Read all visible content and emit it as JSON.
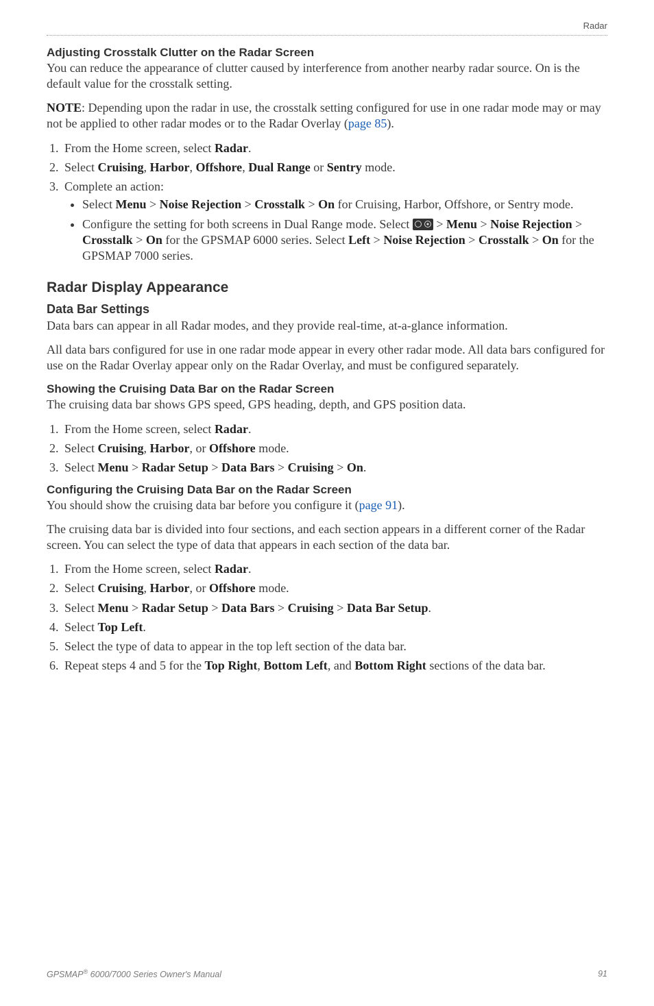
{
  "header": {
    "section": "Radar"
  },
  "s1": {
    "title": "Adjusting Crosstalk Clutter on the Radar Screen",
    "p1a": "You can reduce the appearance of clutter caused by interference from another nearby radar source. On is the default value for the crosstalk setting.",
    "p2_pre": "NOTE",
    "p2_body": ": Depending upon the radar in use, the crosstalk setting configured for use in one radar mode may or may not be applied to other radar modes or to the Radar Overlay (",
    "p2_link": "page 85",
    "p2_close": ").",
    "li1_pre": "From the Home screen, select ",
    "li1_l1": "Radar",
    "li1_post": ".",
    "li2_pre": "Select ",
    "li2_l1": "Cruising",
    "li2_c1": ", ",
    "li2_l2": "Harbor",
    "li2_c2": ", ",
    "li2_l3": "Offshore",
    "li2_c3": ", ",
    "li2_l4": "Dual Range",
    "li2_c4": " or ",
    "li2_l5": "Sentry",
    "li2_post": " mode.",
    "li3": "Complete an action:",
    "b1_pre": "Select ",
    "b1_l1": "Menu",
    "b1_gt1": " > ",
    "b1_l2": "Noise Rejection",
    "b1_gt2": " > ",
    "b1_l3": "Crosstalk",
    "b1_gt3": " > ",
    "b1_l4": "On",
    "b1_post": " for Cruising, Harbor, Offshore, or Sentry mode.",
    "b2_pre": "Configure the setting for both screens in Dual Range mode. Select ",
    "b2_gt0": " > ",
    "b2_l1": "Menu",
    "b2_gt1": " > ",
    "b2_l2": "Noise Rejection",
    "b2_gt2": " > ",
    "b2_l3": "Crosstalk",
    "b2_gt3": " > ",
    "b2_l4": "On",
    "b2_mid": " for the GPSMAP 6000 series. Select ",
    "b2_l5": "Left",
    "b2_gt4": " > ",
    "b2_l6": "Noise Rejection",
    "b2_gt5": " > ",
    "b2_l7": "Crosstalk",
    "b2_gt6": " > ",
    "b2_l8": "On",
    "b2_post": " for the GPSMAP 7000 series."
  },
  "s2": {
    "title": "Radar Display Appearance",
    "sub1": "Data Bar Settings",
    "p1": "Data bars can appear in all Radar modes, and they provide real-time, at-a-glance information.",
    "p2": "All data bars configured for use in one radar mode appear in every other radar mode. All data bars configured for use on the Radar Overlay appear only on the Radar Overlay, and must be configured separately."
  },
  "s3": {
    "title": "Showing the Cruising Data Bar on the Radar Screen",
    "p1": "The cruising data bar shows GPS speed, GPS heading, depth, and GPS position data.",
    "li1_pre": "From the Home screen, select ",
    "li1_l1": "Radar",
    "li1_post": ".",
    "li2_pre": "Select ",
    "li2_l1": "Cruising",
    "li2_c1": ", ",
    "li2_l2": "Harbor",
    "li2_c2": ", or ",
    "li2_l3": "Offshore",
    "li2_post": " mode.",
    "li3_pre": "Select ",
    "li3_l1": "Menu",
    "li3_gt1": " > ",
    "li3_l2": "Radar Setup",
    "li3_gt2": " > ",
    "li3_l3": "Data Bars",
    "li3_gt3": " > ",
    "li3_l4": "Cruising",
    "li3_gt4": " > ",
    "li3_l5": "On",
    "li3_post": "."
  },
  "s4": {
    "title": "Configuring the Cruising Data Bar on the Radar Screen",
    "p1_pre": "You should show the cruising data bar before you configure it (",
    "p1_link": "page 91",
    "p1_post": ").",
    "p2": "The cruising data bar is divided into four sections, and each section appears in a different corner of the Radar screen. You can select the type of data that appears in each section of the data bar.",
    "li1_pre": "From the Home screen, select ",
    "li1_l1": "Radar",
    "li1_post": ".",
    "li2_pre": "Select ",
    "li2_l1": "Cruising",
    "li2_c1": ", ",
    "li2_l2": "Harbor",
    "li2_c2": ", or ",
    "li2_l3": "Offshore",
    "li2_post": " mode.",
    "li3_pre": "Select ",
    "li3_l1": "Menu",
    "li3_gt1": " > ",
    "li3_l2": "Radar Setup",
    "li3_gt2": " > ",
    "li3_l3": "Data Bars",
    "li3_gt3": " > ",
    "li3_l4": "Cruising",
    "li3_gt4": " > ",
    "li3_l5": "Data Bar Setup",
    "li3_post": ".",
    "li4_pre": "Select ",
    "li4_l1": "Top Left",
    "li4_post": ".",
    "li5": "Select the type of data to appear in the top left section of the data bar.",
    "li6_pre": "Repeat steps 4 and 5 for the ",
    "li6_l1": "Top Right",
    "li6_c1": ", ",
    "li6_l2": "Bottom Left",
    "li6_c2": ", and ",
    "li6_l3": "Bottom Right",
    "li6_post": " sections of the data bar."
  },
  "footer": {
    "left_a": "GPSMAP",
    "left_sup": "®",
    "left_b": " 6000/7000 Series Owner's Manual",
    "page": "91"
  }
}
